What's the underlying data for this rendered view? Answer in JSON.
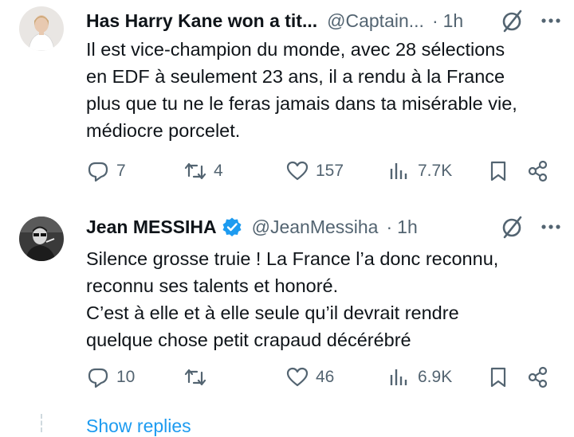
{
  "tweets": [
    {
      "name": "Has Harry Kane won a tit...",
      "handle": "@Captain...",
      "separator": "·",
      "time": "1h",
      "verified": false,
      "avatar_icon": "profile-photo-woman-white-top",
      "lines": [
        "Il est vice-champion du monde, avec 28 sélections",
        "en EDF à seulement 23 ans, il a rendu à la France",
        "plus que tu ne le feras jamais dans ta misérable vie,",
        "médiocre porcelet."
      ],
      "actions": {
        "replies": "7",
        "retweets": "4",
        "likes": "157",
        "views": "7.7K"
      }
    },
    {
      "name": "Jean MESSIHA",
      "handle": "@JeanMessiha",
      "separator": "·",
      "time": "1h",
      "verified": true,
      "avatar_icon": "profile-photo-man-black-and-white",
      "lines": [
        "Silence grosse truie ! La France l’a donc reconnu,",
        "reconnu ses talents et honoré.",
        "C’est à elle et à elle seule qu’il devrait rendre",
        "quelque chose petit crapaud décérébré"
      ],
      "actions": {
        "replies": "10",
        "retweets": "",
        "likes": "46",
        "views": "6.9K"
      }
    }
  ],
  "show_replies_label": "Show replies",
  "colors": {
    "text": "#0f1419",
    "secondary": "#536471",
    "link": "#1d9bf0",
    "verified": "#1d9bf0"
  }
}
